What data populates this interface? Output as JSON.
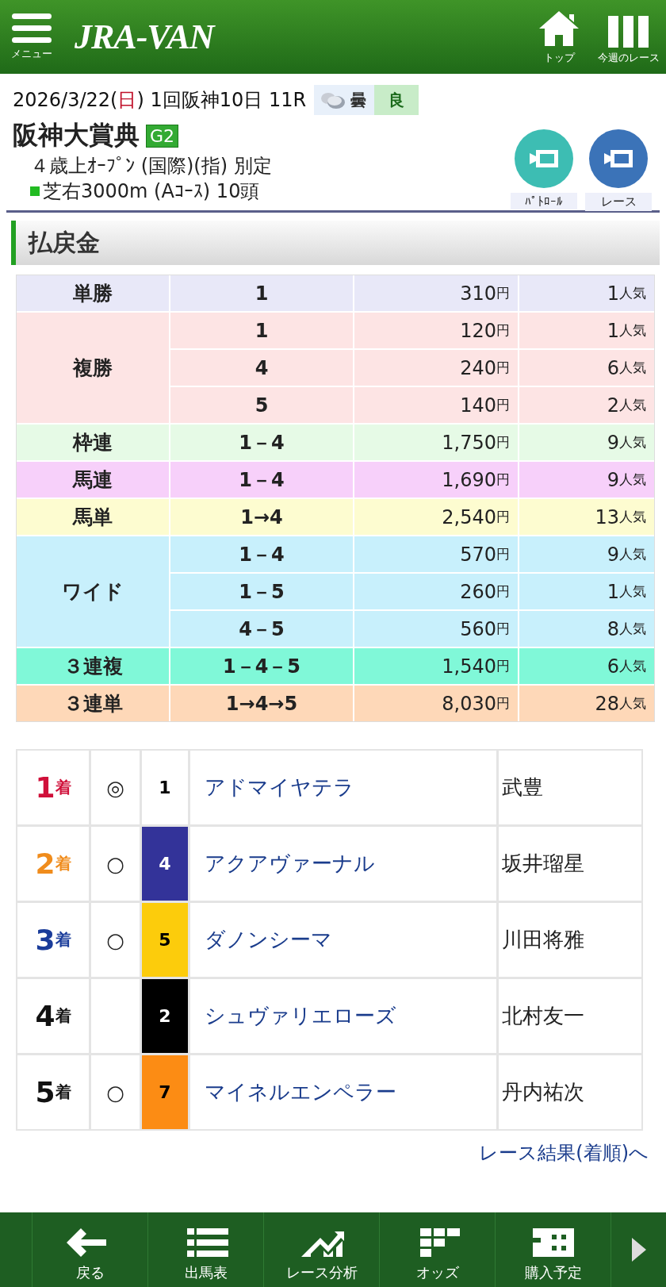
{
  "header": {
    "menu_label": "メニュー",
    "logo": "JRA-VAN",
    "links": [
      {
        "kind": "home",
        "label": "トップ"
      },
      {
        "kind": "week",
        "label": "今週のレース"
      }
    ]
  },
  "race": {
    "date_before": "2026/3/22(",
    "weekday": "日",
    "date_after": ")",
    "meeting": "1回阪神10日 11R",
    "weather": "曇",
    "going": "良",
    "title": "阪神大賞典",
    "grade": "G2",
    "conditions": "４歳上ｵｰﾌﾟﾝ (国際)(指) 別定",
    "course": "芝右3000m (Aｺｰｽ) 10頭",
    "videos": [
      {
        "label": "ﾊﾟﾄﾛｰﾙ",
        "color": "#3dbdb3"
      },
      {
        "label": "レース",
        "color": "#3b73b8"
      }
    ]
  },
  "payouts": {
    "heading": "払戻金",
    "groups": [
      {
        "type": "単勝",
        "color": "#e8e8f8",
        "rows": [
          {
            "combo": "1",
            "amount": "310",
            "amount_unit": "円",
            "popularity": "1",
            "popularity_unit": "人気"
          }
        ]
      },
      {
        "type": "複勝",
        "color": "#fde4e4",
        "rows": [
          {
            "combo": "1",
            "amount": "120",
            "amount_unit": "円",
            "popularity": "1",
            "popularity_unit": "人気"
          },
          {
            "combo": "4",
            "amount": "240",
            "amount_unit": "円",
            "popularity": "6",
            "popularity_unit": "人気"
          },
          {
            "combo": "5",
            "amount": "140",
            "amount_unit": "円",
            "popularity": "2",
            "popularity_unit": "人気"
          }
        ]
      },
      {
        "type": "枠連",
        "color": "#e6fae6",
        "rows": [
          {
            "combo": "1－4",
            "amount": "1,750",
            "amount_unit": "円",
            "popularity": "9",
            "popularity_unit": "人気"
          }
        ]
      },
      {
        "type": "馬連",
        "color": "#f7d0fa",
        "rows": [
          {
            "combo": "1－4",
            "amount": "1,690",
            "amount_unit": "円",
            "popularity": "9",
            "popularity_unit": "人気"
          }
        ]
      },
      {
        "type": "馬単",
        "color": "#fdfcd0",
        "rows": [
          {
            "combo": "1→4",
            "amount": "2,540",
            "amount_unit": "円",
            "popularity": "13",
            "popularity_unit": "人気"
          }
        ]
      },
      {
        "type": "ワイド",
        "color": "#c8f0fc",
        "rows": [
          {
            "combo": "1－4",
            "amount": "570",
            "amount_unit": "円",
            "popularity": "9",
            "popularity_unit": "人気"
          },
          {
            "combo": "1－5",
            "amount": "260",
            "amount_unit": "円",
            "popularity": "1",
            "popularity_unit": "人気"
          },
          {
            "combo": "4－5",
            "amount": "560",
            "amount_unit": "円",
            "popularity": "8",
            "popularity_unit": "人気"
          }
        ]
      },
      {
        "type": "３連複",
        "color": "#80f8d8",
        "rows": [
          {
            "combo": "1－4－5",
            "amount": "1,540",
            "amount_unit": "円",
            "popularity": "6",
            "popularity_unit": "人気"
          }
        ]
      },
      {
        "type": "３連単",
        "color": "#fed8b8",
        "rows": [
          {
            "combo": "1→4→5",
            "amount": "8,030",
            "amount_unit": "円",
            "popularity": "28",
            "popularity_unit": "人気"
          }
        ]
      }
    ]
  },
  "results": [
    {
      "place": "1",
      "place_unit": "着",
      "color": "#d0103a",
      "mark": "◎",
      "frame": {
        "number": "1",
        "color": "#ffffff"
      },
      "horse": "アドマイヤテラ",
      "jockey": "武豊"
    },
    {
      "place": "2",
      "place_unit": "着",
      "color": "#f08c1c",
      "mark": "○",
      "frame": {
        "number": "4",
        "color": "#333399"
      },
      "horse": "アクアヴァーナル",
      "jockey": "坂井瑠星"
    },
    {
      "place": "3",
      "place_unit": "着",
      "color": "#1a3c9a",
      "mark": "○",
      "frame": {
        "number": "5",
        "color": "#fccc0c"
      },
      "horse": "ダノンシーマ",
      "jockey": "川田将雅"
    },
    {
      "place": "4",
      "place_unit": "着",
      "color": "#111111",
      "frame": {
        "number": "2",
        "color": "#000000"
      },
      "horse": "シュヴァリエローズ",
      "jockey": "北村友一"
    },
    {
      "place": "5",
      "place_unit": "着",
      "color": "#111111",
      "mark": "○",
      "frame": {
        "number": "7",
        "color": "#fc8c14"
      },
      "horse": "マイネルエンペラー",
      "jockey": "丹内祐次"
    }
  ],
  "results_link": "レース結果(着順)へ",
  "bottom_nav": [
    {
      "kind": "back",
      "label": "戻る"
    },
    {
      "kind": "list",
      "label": "出馬表"
    },
    {
      "kind": "analysis",
      "label": "レース分析"
    },
    {
      "kind": "odds",
      "label": "オッズ"
    },
    {
      "kind": "plan",
      "label": "購入予定"
    }
  ]
}
